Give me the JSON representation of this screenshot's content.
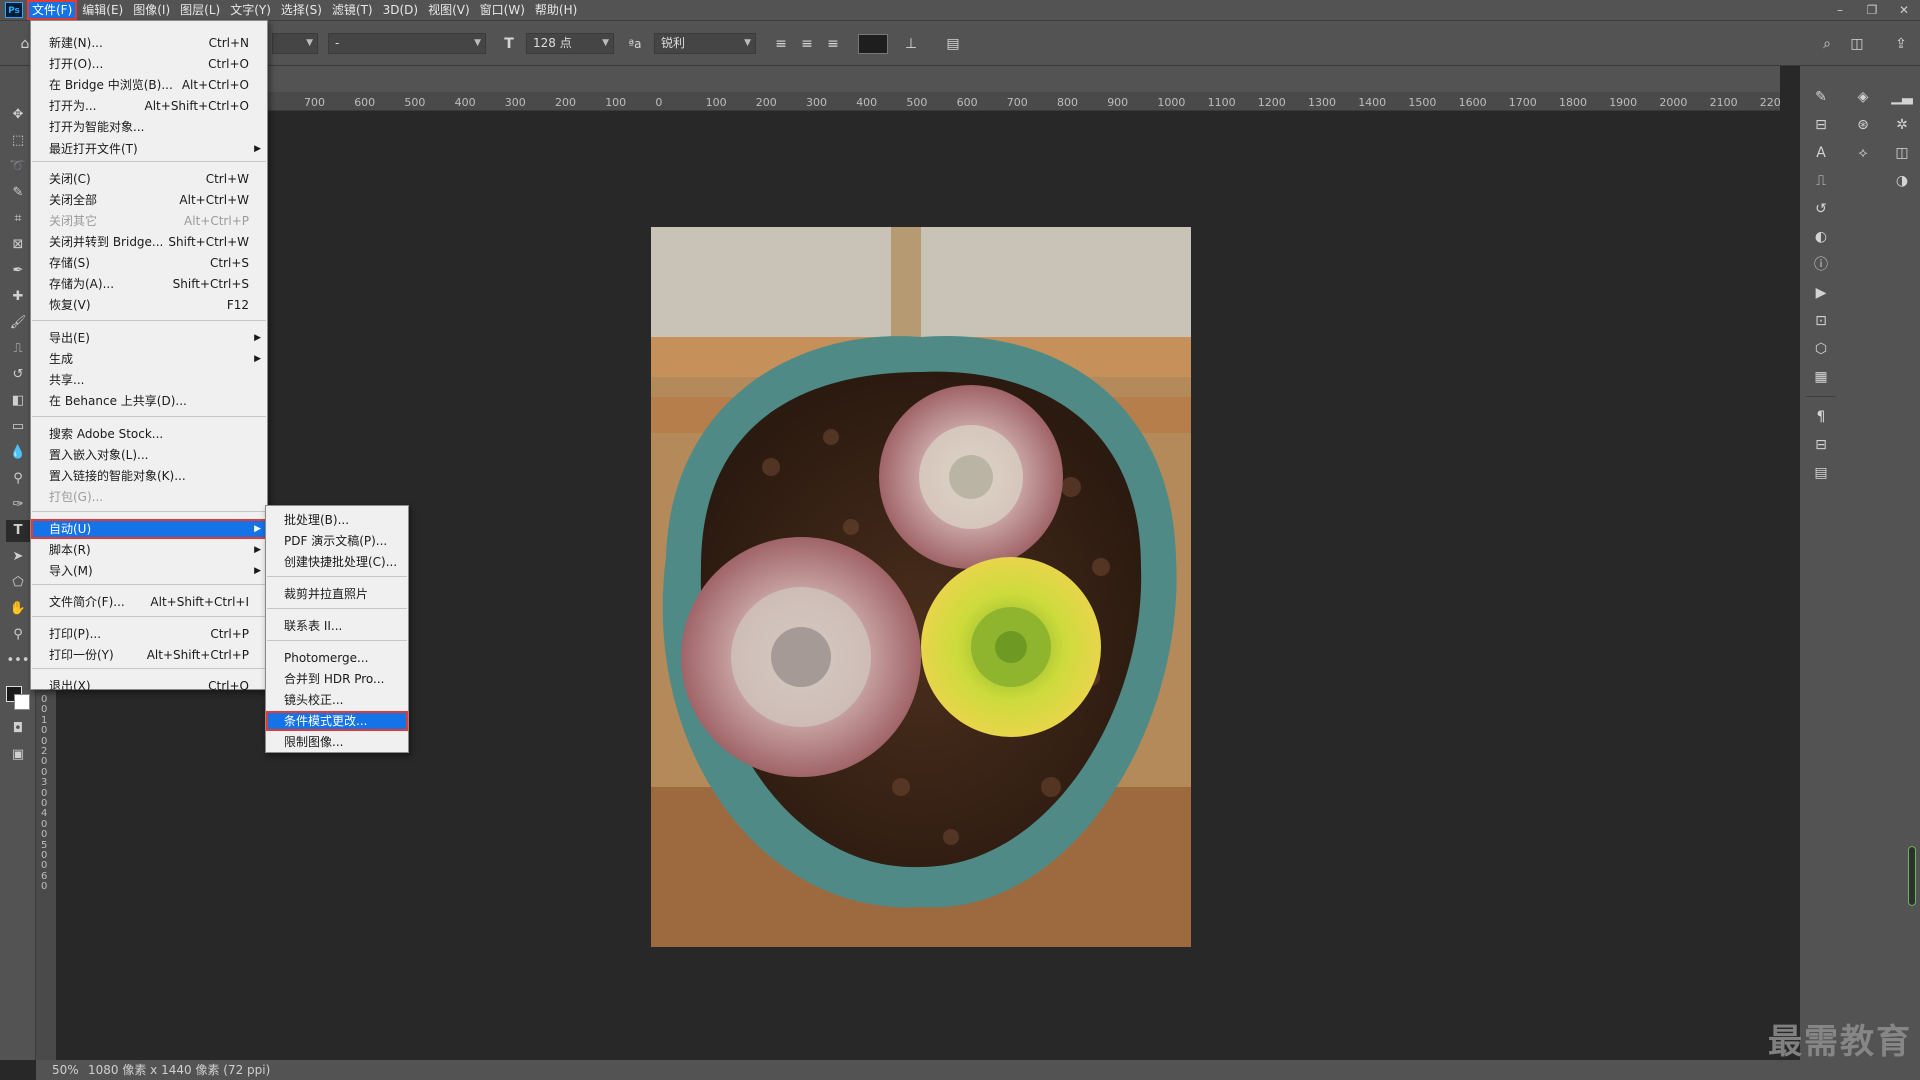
{
  "app": {
    "logo": "Ps"
  },
  "menubar": {
    "items": [
      "文件(F)",
      "编辑(E)",
      "图像(I)",
      "图层(L)",
      "文字(Y)",
      "选择(S)",
      "滤镜(T)",
      "3D(D)",
      "视图(V)",
      "窗口(W)",
      "帮助(H)"
    ],
    "active_index": 0,
    "window_controls": [
      "–",
      "❐",
      "✕"
    ]
  },
  "options": {
    "font_style": "-",
    "font_size": "128 点",
    "antialias_label": "ªa",
    "antialias": "锐利"
  },
  "ruler": {
    "top_labels": [
      "700",
      "600",
      "500",
      "400",
      "300",
      "200",
      "100",
      "0",
      "100",
      "200",
      "300",
      "400",
      "500",
      "600",
      "700",
      "800",
      "900",
      "1000",
      "1100",
      "1200",
      "1300",
      "1400",
      "1500",
      "1600",
      "1700",
      "1800",
      "1900",
      "2000",
      "2100",
      "2200"
    ],
    "left_digits": [
      "0",
      "0",
      "1",
      "0",
      "0",
      "2",
      "0",
      "0",
      "3",
      "0",
      "0",
      "4",
      "0",
      "0",
      "5",
      "0",
      "0",
      "6",
      "0"
    ]
  },
  "file_menu": {
    "items": [
      {
        "label": "新建(N)...",
        "shortcut": "Ctrl+N"
      },
      {
        "label": "打开(O)...",
        "shortcut": "Ctrl+O"
      },
      {
        "label": "在 Bridge 中浏览(B)...",
        "shortcut": "Alt+Ctrl+O"
      },
      {
        "label": "打开为...",
        "shortcut": "Alt+Shift+Ctrl+O"
      },
      {
        "label": "打开为智能对象...",
        "shortcut": ""
      },
      {
        "label": "最近打开文件(T)",
        "shortcut": "",
        "submenu": true
      },
      {
        "label": "关闭(C)",
        "shortcut": "Ctrl+W"
      },
      {
        "label": "关闭全部",
        "shortcut": "Alt+Ctrl+W"
      },
      {
        "label": "关闭其它",
        "shortcut": "Alt+Ctrl+P",
        "disabled": true
      },
      {
        "label": "关闭并转到 Bridge...",
        "shortcut": "Shift+Ctrl+W"
      },
      {
        "label": "存储(S)",
        "shortcut": "Ctrl+S"
      },
      {
        "label": "存储为(A)...",
        "shortcut": "Shift+Ctrl+S"
      },
      {
        "label": "恢复(V)",
        "shortcut": "F12"
      },
      {
        "label": "导出(E)",
        "shortcut": "",
        "submenu": true
      },
      {
        "label": "生成",
        "shortcut": "",
        "submenu": true
      },
      {
        "label": "共享...",
        "shortcut": ""
      },
      {
        "label": "在 Behance 上共享(D)...",
        "shortcut": ""
      },
      {
        "label": "搜索 Adobe Stock...",
        "shortcut": ""
      },
      {
        "label": "置入嵌入对象(L)...",
        "shortcut": ""
      },
      {
        "label": "置入链接的智能对象(K)...",
        "shortcut": ""
      },
      {
        "label": "打包(G)...",
        "shortcut": "",
        "disabled": true
      },
      {
        "label": "自动(U)",
        "shortcut": "",
        "submenu": true,
        "highlight": true
      },
      {
        "label": "脚本(R)",
        "shortcut": "",
        "submenu": true
      },
      {
        "label": "导入(M)",
        "shortcut": "",
        "submenu": true
      },
      {
        "label": "文件简介(F)...",
        "shortcut": "Alt+Shift+Ctrl+I"
      },
      {
        "label": "打印(P)...",
        "shortcut": "Ctrl+P"
      },
      {
        "label": "打印一份(Y)",
        "shortcut": "Alt+Shift+Ctrl+P"
      },
      {
        "label": "退出(X)",
        "shortcut": "Ctrl+Q"
      }
    ]
  },
  "automate_menu": {
    "items": [
      {
        "label": "批处理(B)..."
      },
      {
        "label": "PDF 演示文稿(P)..."
      },
      {
        "label": "创建快捷批处理(C)..."
      },
      {
        "label": "裁剪并拉直照片"
      },
      {
        "label": "联系表 II..."
      },
      {
        "label": "Photomerge..."
      },
      {
        "label": "合并到 HDR Pro..."
      },
      {
        "label": "镜头校正..."
      },
      {
        "label": "条件模式更改...",
        "highlight": true
      },
      {
        "label": "限制图像..."
      }
    ]
  },
  "status": {
    "zoom": "50%",
    "doc_info": "1080 像素 x 1440 像素 (72 ppi)"
  },
  "watermark": "最需教育",
  "colors": {
    "accent": "#1473e6",
    "highlight_border": "#e53935"
  }
}
